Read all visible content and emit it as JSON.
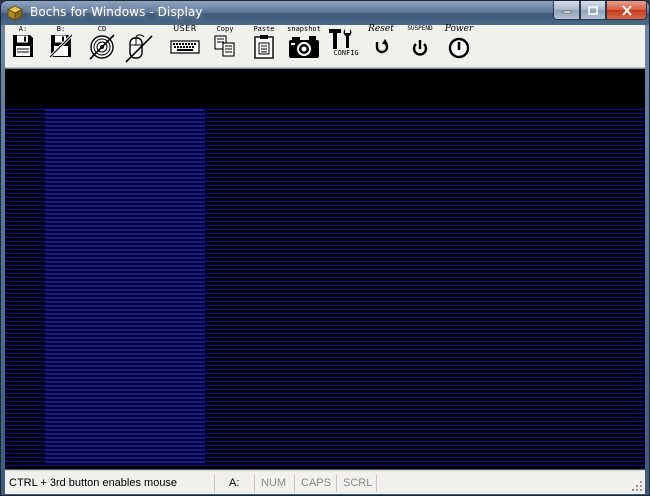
{
  "window": {
    "title": "Bochs for Windows - Display"
  },
  "toolbar": {
    "floppy_a": "A:",
    "floppy_b": "B:",
    "cdrom": "CD",
    "user": "USER",
    "copy": "Copy",
    "paste": "Paste",
    "snapshot": "snapshot",
    "config": "CONFIG",
    "reset": "Reset",
    "suspend": "SUSPEND",
    "power": "Power"
  },
  "statusbar": {
    "message": "CTRL + 3rd button enables mouse",
    "drive": "A:",
    "num": "NUM",
    "caps": "CAPS",
    "scrl": "SCRL"
  },
  "colors": {
    "screen_bg": "#000000",
    "scanline": "#0a0c9a",
    "scanline_bright": "#1414b8"
  }
}
